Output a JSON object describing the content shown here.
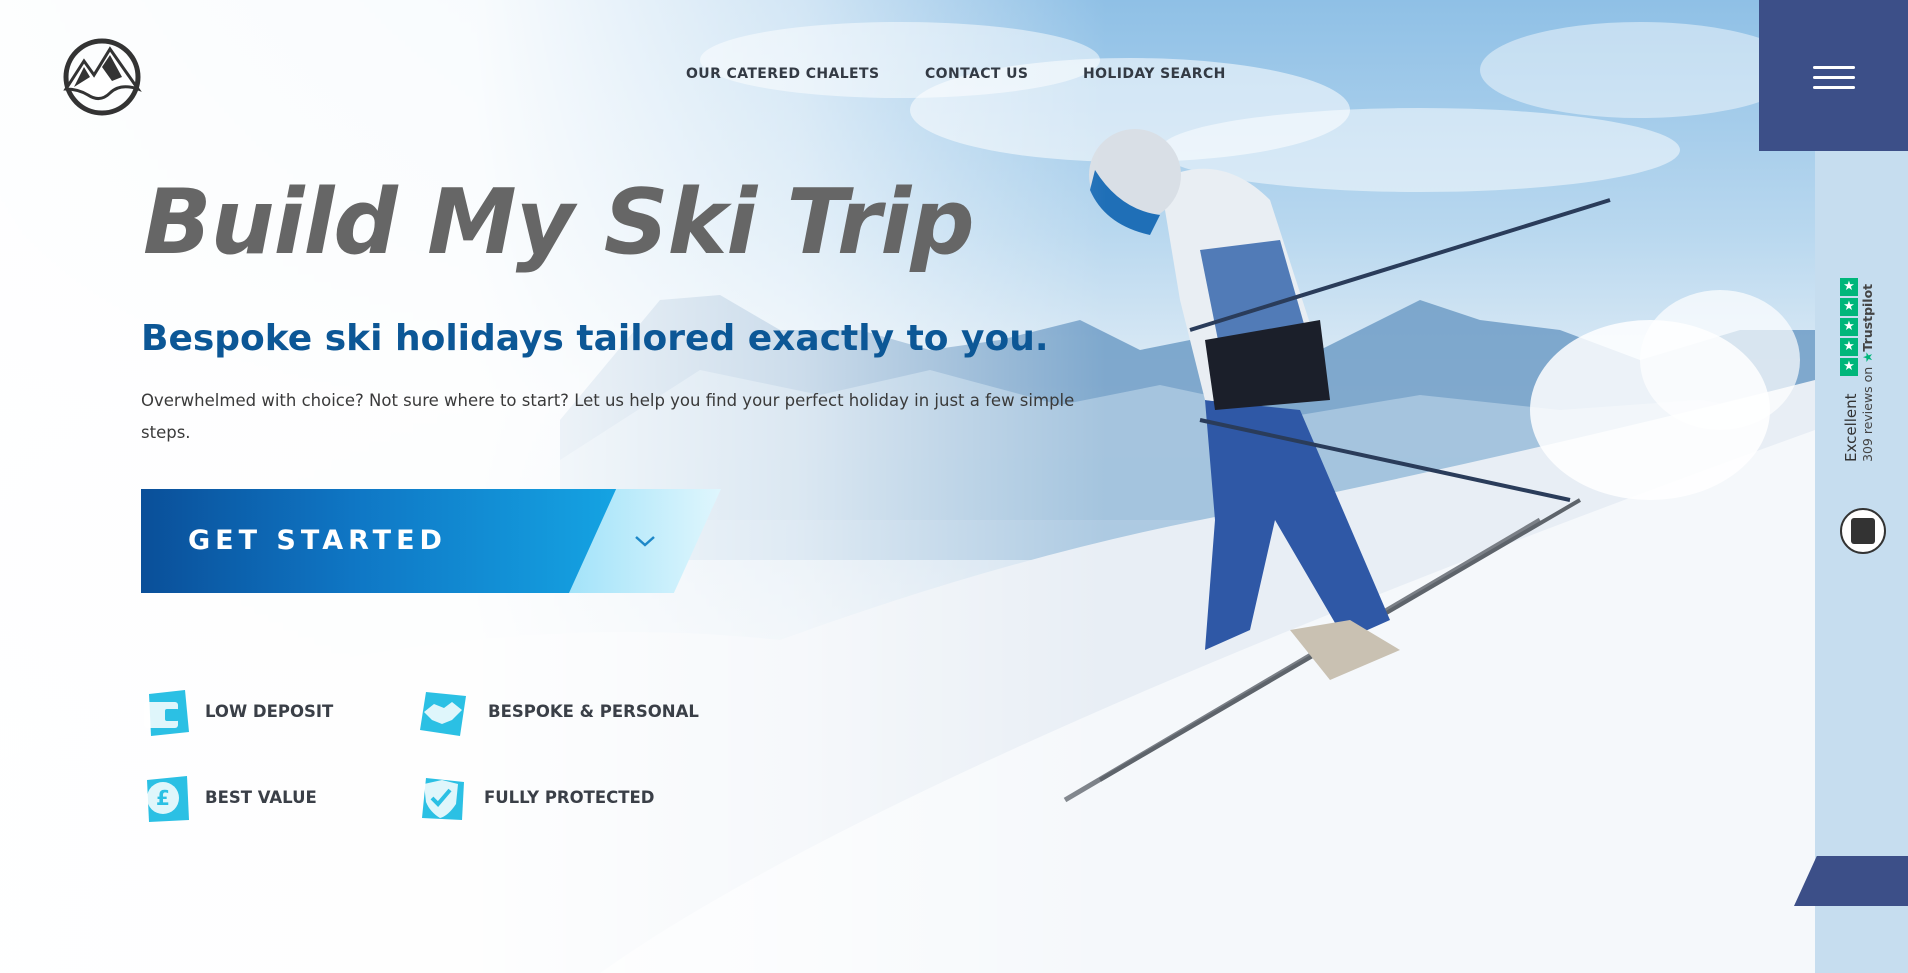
{
  "nav": {
    "links": [
      "OUR CATERED CHALETS",
      "CONTACT US",
      "HOLIDAY SEARCH"
    ]
  },
  "hero": {
    "title": "Build My Ski Trip",
    "subtitle": "Bespoke ski holidays tailored exactly to you.",
    "description": "Overwhelmed with choice? Not sure where to start? Let us help you find your perfect holiday in just a few simple steps."
  },
  "cta": {
    "label": "GET STARTED",
    "icon": "chevron-down-icon"
  },
  "features": [
    {
      "label": "LOW DEPOSIT",
      "icon": "wallet-icon"
    },
    {
      "label": "BESPOKE & PERSONAL",
      "icon": "handshake-icon"
    },
    {
      "label": "BEST VALUE",
      "icon": "pound-icon"
    },
    {
      "label": "FULLY PROTECTED",
      "icon": "shield-check-icon"
    }
  ],
  "menu": {
    "icon": "hamburger-menu-icon"
  },
  "trustpilot": {
    "rating_word": "Excellent",
    "reviews_text": "309 reviews on",
    "brand": "Trustpilot",
    "stars": 5
  },
  "colors": {
    "brand_navy": "#3c4f88",
    "title_grey": "#666666",
    "subtitle_blue": "#0c5796",
    "cta_gradient_start": "#0a4f99",
    "cta_gradient_end": "#15a4e3",
    "icon_cyan": "#2bc0e4",
    "side_strip": "#c6ddef",
    "trustpilot_green": "#00b67a"
  }
}
